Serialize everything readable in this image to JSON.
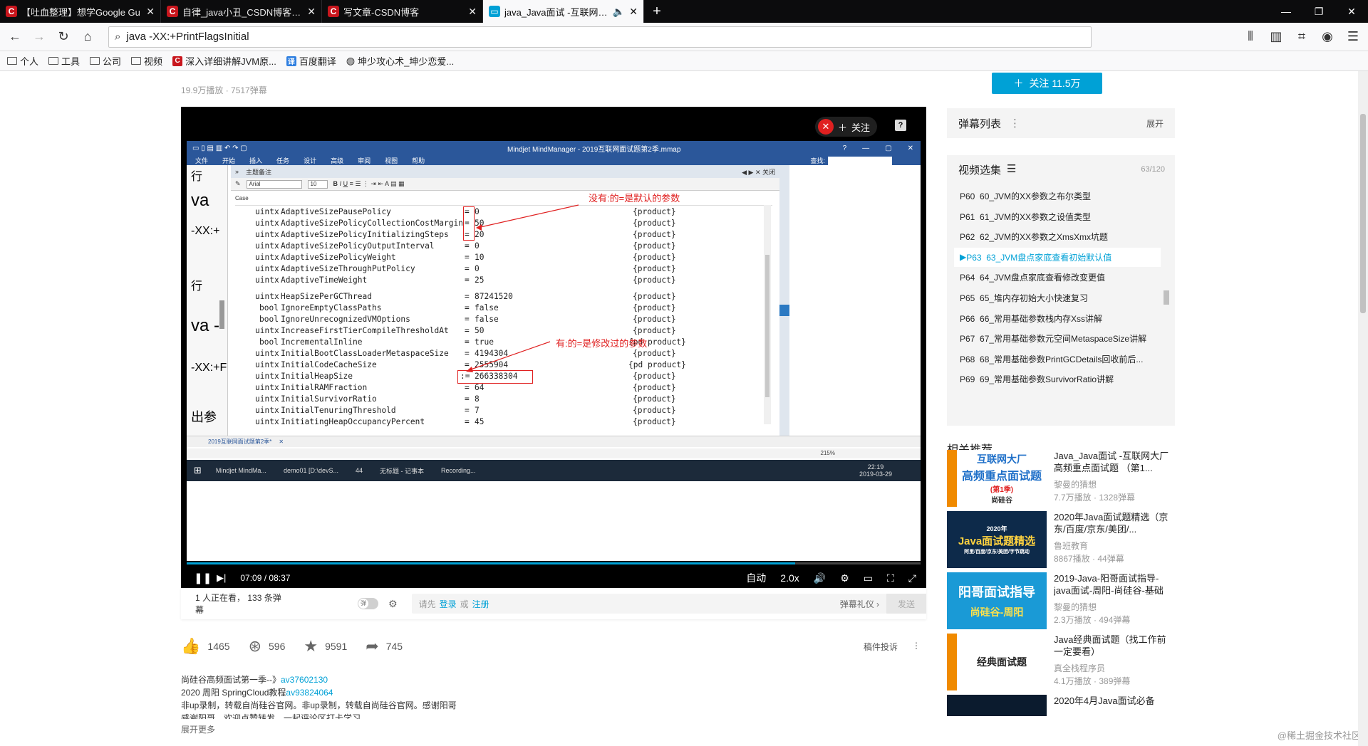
{
  "browser": {
    "tabs": [
      {
        "icon": "C",
        "label": "【吐血整理】想学Google Gu"
      },
      {
        "icon": "C",
        "label": "自律_java小丑_CSDN博客-We"
      },
      {
        "icon": "C",
        "label": "写文章-CSDN博客"
      },
      {
        "icon": "tv",
        "label": "java_Java面试 -互联网大厂"
      }
    ],
    "url": "java -XX:+PrintFlagsInitial",
    "bookmarks": [
      {
        "icon": "folder",
        "label": "个人"
      },
      {
        "icon": "folder",
        "label": "工具"
      },
      {
        "icon": "folder",
        "label": "公司"
      },
      {
        "icon": "folder",
        "label": "视频"
      },
      {
        "icon": "csdn",
        "label": "深入详细讲解JVM原..."
      },
      {
        "icon": "translate",
        "label": "百度翻译"
      },
      {
        "icon": "globe",
        "label": "坤少攻心术_坤少恋爱..."
      }
    ]
  },
  "video": {
    "stats": "19.9万播放 · 7517弹幕",
    "follow_big": "关注 11.5万",
    "player_follow": "关注",
    "current_time": "07:09",
    "total_time": "08:37",
    "progress": 0.829,
    "quality": "自动",
    "speed": "2.0x"
  },
  "mindmanager": {
    "title": "Mindjet MindManager - 2019互联网面试题第2季.mmap",
    "menu": [
      "文件",
      "开始",
      "插入",
      "任务",
      "设计",
      "高级",
      "审阅",
      "视图",
      "帮助"
    ],
    "search_label": "查找:",
    "pane_title": "主题备注",
    "pane_close": "关闭",
    "font_name": "Arial",
    "font_size": "10",
    "case_label": "Case",
    "left_fragments": [
      "va",
      "-XX:+",
      "行",
      "va  -",
      "-XX:+F",
      "出参"
    ],
    "rows": [
      {
        "type": "uintx",
        "name": "AdaptiveSizePausePolicy",
        "op": "=",
        "value": "0",
        "kind": "{product}"
      },
      {
        "type": "uintx",
        "name": "AdaptiveSizePolicyCollectionCostMargin",
        "op": "=",
        "value": "50",
        "kind": "{product}"
      },
      {
        "type": "uintx",
        "name": "AdaptiveSizePolicyInitializingSteps",
        "op": "=",
        "value": "20",
        "kind": "{product}"
      },
      {
        "type": "uintx",
        "name": "AdaptiveSizePolicyOutputInterval",
        "op": "=",
        "value": "0",
        "kind": "{product}"
      },
      {
        "type": "uintx",
        "name": "AdaptiveSizePolicyWeight",
        "op": "=",
        "value": "10",
        "kind": "{product}"
      },
      {
        "type": "uintx",
        "name": "AdaptiveSizeThroughPutPolicy",
        "op": "=",
        "value": "0",
        "kind": "{product}"
      },
      {
        "type": "uintx",
        "name": "AdaptiveTimeWeight",
        "op": "=",
        "value": "25",
        "kind": "{product}"
      },
      {
        "type": "uintx",
        "name": "HeapSizePerGCThread",
        "op": "=",
        "value": "87241520",
        "kind": "{product}"
      },
      {
        "type": "bool",
        "name": "IgnoreEmptyClassPaths",
        "op": "=",
        "value": "false",
        "kind": "{product}"
      },
      {
        "type": "bool",
        "name": "IgnoreUnrecognizedVMOptions",
        "op": "=",
        "value": "false",
        "kind": "{product}"
      },
      {
        "type": "uintx",
        "name": "IncreaseFirstTierCompileThresholdAt",
        "op": "=",
        "value": "50",
        "kind": "{product}"
      },
      {
        "type": "bool",
        "name": "IncrementalInline",
        "op": "=",
        "value": "true",
        "kind": "{pd product}"
      },
      {
        "type": "uintx",
        "name": "InitialBootClassLoaderMetaspaceSize",
        "op": "=",
        "value": "4194304",
        "kind": "{product}"
      },
      {
        "type": "uintx",
        "name": "InitialCodeCacheSize",
        "op": "=",
        "value": "2555904",
        "kind": "{pd product}"
      },
      {
        "type": "uintx",
        "name": "InitialHeapSize",
        "op": ":=",
        "value": "266338304",
        "kind": "{product}"
      },
      {
        "type": "uintx",
        "name": "InitialRAMFraction",
        "op": "=",
        "value": "64",
        "kind": "{product}"
      },
      {
        "type": "uintx",
        "name": "InitialSurvivorRatio",
        "op": "=",
        "value": "8",
        "kind": "{product}"
      },
      {
        "type": "uintx",
        "name": "InitialTenuringThreshold",
        "op": "=",
        "value": "7",
        "kind": "{product}"
      },
      {
        "type": "uintx",
        "name": "InitiatingHeapOccupancyPercent",
        "op": "=",
        "value": "45",
        "kind": "{product}"
      }
    ],
    "annotation_default": "没有:的=是默认的参数",
    "annotation_modified": "有:的=是修改过的参数",
    "doc_tab": "2019互联网面试题第2季*",
    "zoom": "215%",
    "taskbar": [
      "Mindjet MindMa...",
      "demo01 [D:\\devS...",
      "44",
      "无标题 - 记事本",
      "Recording..."
    ],
    "taskbar_clock_time": "22:19",
    "taskbar_clock_date": "2019-03-29"
  },
  "danmaku_bar": {
    "viewers": "1 人正在看",
    "count": "133 条弹幕",
    "placeholder_prefix": "请先",
    "login": "登录",
    "or": "或",
    "register": "注册",
    "etiquette": "弹幕礼仪 ›",
    "send": "发送"
  },
  "actions": {
    "like": "1465",
    "coin": "596",
    "favorite": "9591",
    "share": "745",
    "report": "稿件投诉"
  },
  "description": {
    "line1_text": "尚硅谷高频面试第一季--》",
    "line1_link": "av37602130",
    "line2_text": "2020 周阳 SpringCloud教程",
    "line2_link": "av93824064",
    "line3": "非up录制，转载自尚硅谷官网。非up录制，转载自尚硅谷官网。感谢阳哥",
    "line4": "感谢阳哥，欢迎点赞转发，一起评论区打卡学习",
    "more": "展开更多"
  },
  "sidebar": {
    "danmaku_title": "弹幕列表",
    "expand": "展开",
    "playlist_title": "视频选集",
    "playlist_count": "63/120",
    "playlist": [
      {
        "label": "P60  60_JVM的XX参数之布尔类型",
        "current": false
      },
      {
        "label": "P61  61_JVM的XX参数之设值类型",
        "current": false
      },
      {
        "label": "P62  62_JVM的XX参数之XmsXmx坑题",
        "current": false
      },
      {
        "label": "P63  63_JVM盘点家底查看初始默认值",
        "current": true
      },
      {
        "label": "P64  64_JVM盘点家底查看修改变更值",
        "current": false
      },
      {
        "label": "P65  65_堆内存初始大小快速复习",
        "current": false
      },
      {
        "label": "P66  66_常用基础参数栈内存Xss讲解",
        "current": false
      },
      {
        "label": "P67  67_常用基础参数元空间MetaspaceSize讲解",
        "current": false
      },
      {
        "label": "P68  68_常用基础参数PrintGCDetails回收前后...",
        "current": false
      },
      {
        "label": "P69  69_常用基础参数SurvivorRatio讲解",
        "current": false
      }
    ],
    "related_title": "相关推荐",
    "related": [
      {
        "thumb_line1": "互联网大厂",
        "thumb_line2": "高频重点面试题",
        "thumb_line3": "(第1季)",
        "thumb_line4": "尚硅谷",
        "title": "Java_Java面试 -互联网大厂高频重点面试题 （第1...",
        "author": "黎曼的猜想",
        "stats": "7.7万播放 · 1328弹幕"
      },
      {
        "thumb_line1": "2020年",
        "thumb_line2": "Java面试题精选",
        "thumb_line3": "阿里/百度/京东/美团/字节跳动",
        "thumb_line4": "",
        "title": "2020年Java面试题精选（京东/百度/京东/美团/...",
        "author": "鲁班教育",
        "stats": "8867播放 · 44弹幕"
      },
      {
        "thumb_line1": "阳哥面试指导",
        "thumb_line2": "尚硅谷-周阳",
        "thumb_line3": "",
        "thumb_line4": "",
        "title": "2019-Java-阳哥面试指导-java面试-周阳-尚硅谷-基础",
        "author": "黎曼的猜想",
        "stats": "2.3万播放 · 494弹幕"
      },
      {
        "thumb_line1": "经典面试题",
        "thumb_line2": "",
        "thumb_line3": "",
        "thumb_line4": "",
        "title": "Java经典面试题（找工作前一定要看）",
        "author": "真全栈程序员",
        "stats": "4.1万播放 · 389弹幕"
      },
      {
        "thumb_line1": "",
        "thumb_line2": "",
        "thumb_line3": "",
        "thumb_line4": "",
        "title": "2020年4月Java面试必备",
        "author": "",
        "stats": ""
      }
    ],
    "watermark": "@稀土掘金技术社区"
  }
}
